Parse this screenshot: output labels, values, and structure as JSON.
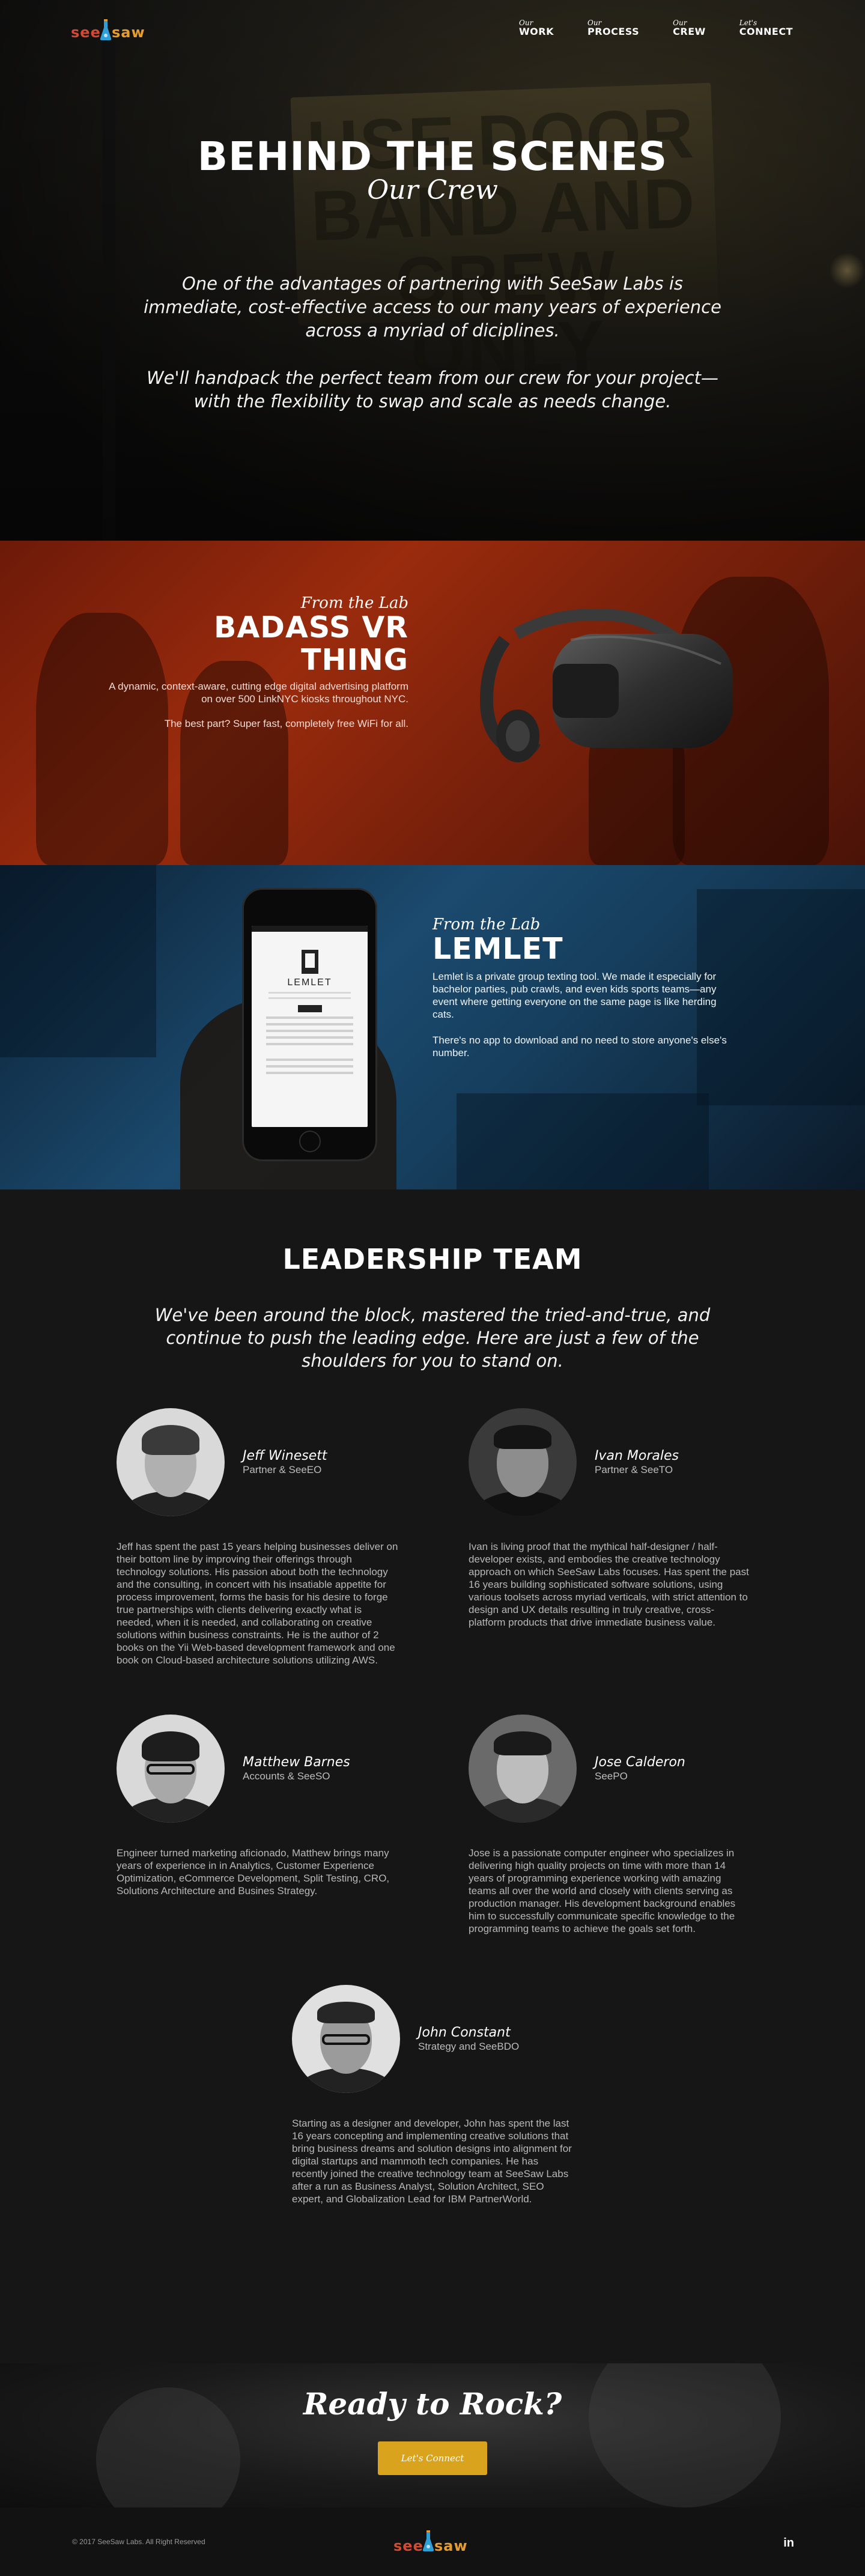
{
  "brand": {
    "see": "see",
    "saw": "saw",
    "accent": "#d9a31e"
  },
  "nav": {
    "items": [
      {
        "small": "Our",
        "big": "WORK"
      },
      {
        "small": "Our",
        "big": "PROCESS"
      },
      {
        "small": "Our",
        "big": "CREW"
      },
      {
        "small": "Let's",
        "big": "CONNECT"
      }
    ]
  },
  "hero": {
    "title": "BEHIND THE SCENES",
    "subtitle": "Our Crew",
    "p1": "One of the advantages of partnering with SeeSaw Labs is immediate, cost-effective access to our many years of experience across a myriad of diciplines.",
    "p2": "We'll handpack the perfect team from our crew for your project—with the flexibility to swap and scale as needs change."
  },
  "vr": {
    "tag": "From the Lab",
    "title": "BADASS VR THING",
    "p1": "A dynamic, context-aware, cutting edge digital advertising platform on over 500 LinkNYC kiosks throughout NYC.",
    "p2": "The best part? Super fast, completely free WiFi for all."
  },
  "lemlet": {
    "tag": "From the Lab",
    "title": "LEMLET",
    "p1": "Lemlet is a private group texting tool. We made it especially for bachelor parties, pub crawls, and even kids sports teams—any event where getting everyone on the same page is like herding cats.",
    "p2": "There's no app to download and no need to store anyone's else's number.",
    "phone_logo": "LEMLET"
  },
  "leadership": {
    "title": "LEADERSHIP TEAM",
    "intro": "We've been around the block, mastered the tried-and-true, and continue to push the leading edge. Here are just a few of the shoulders for you to stand on.",
    "members": [
      {
        "name": "Jeff Winesett",
        "role": "Partner & SeeEO",
        "bio": "Jeff has spent the past 15 years helping businesses deliver on their bottom line by improving their offerings through technology solutions. His passion about both the technology and the consulting, in concert with his insatiable appetite for process improvement, forms the basis for his desire to forge true partnerships with clients delivering exactly what is needed, when it is needed, and collaborating on creative solutions within business constraints. He is the author of 2 books on the Yii Web-based development framework and one book on Cloud-based architecture solutions utilizing AWS."
      },
      {
        "name": "Ivan Morales",
        "role": "Partner & SeeTO",
        "bio": "Ivan is living proof that the mythical half-designer / half-developer exists, and embodies the creative technology approach on which SeeSaw Labs focuses. Has spent the past 16 years building sophisticated software solutions, using various toolsets across myriad verticals, with strict attention to design and UX details resulting in truly creative, cross-platform products that drive immediate business value."
      },
      {
        "name": "Matthew Barnes",
        "role": "Accounts & SeeSO",
        "bio": "Engineer turned marketing aficionado, Matthew brings many years of experience in in Analytics, Customer Experience Optimization, eCommerce Development, Split Testing, CRO, Solutions Architecture and Busines Strategy."
      },
      {
        "name": "Jose Calderon",
        "role": "SeePO",
        "bio": "Jose is a passionate computer engineer who specializes in delivering high quality projects on time with more than 14 years of programming experience working with amazing teams all over the world and closely with clients serving as production manager. His development background enables him to successfully communicate specific knowledge to the programming teams to achieve the goals set forth."
      },
      {
        "name": "John Constant",
        "role": "Strategy and SeeBDO",
        "bio": "Starting as a designer and developer, John has spent the last 16 years concepting and implementing creative solutions that bring business dreams and solution designs into alignment for digital startups and mammoth tech companies. He has recently joined the creative technology team at SeeSaw Labs after a run as Business Analyst, Solution Architect, SEO expert, and Globalization Lead for IBM PartnerWorld."
      }
    ]
  },
  "cta": {
    "title": "Ready to Rock?",
    "button": "Let's Connect"
  },
  "footer": {
    "copyright": "© 2017 SeeSaw Labs. All Right Reserved",
    "social": "in"
  }
}
